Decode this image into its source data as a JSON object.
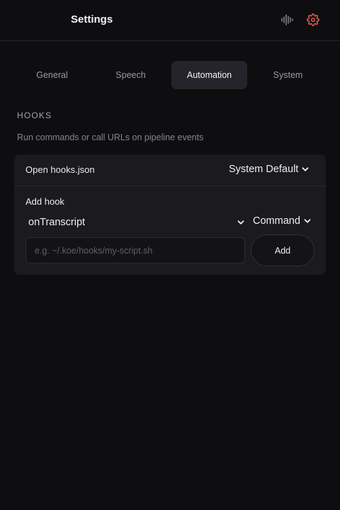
{
  "header": {
    "title": "Settings",
    "icons": {
      "waveform": "waveform-icon",
      "gear": "gear-icon"
    },
    "gear_color": "#e0604f"
  },
  "tabs": [
    {
      "label": "General",
      "active": false
    },
    {
      "label": "Speech",
      "active": false
    },
    {
      "label": "Automation",
      "active": true
    },
    {
      "label": "System",
      "active": false
    }
  ],
  "hooks": {
    "section_label": "HOOKS",
    "description": "Run commands or call URLs on pipeline events",
    "open_label": "Open hooks.json",
    "open_with": "System Default",
    "add_label": "Add hook",
    "event": "onTranscript",
    "type": "Command",
    "input_placeholder": "e.g. ~/.koe/hooks/my-script.sh",
    "input_value": "",
    "add_button": "Add"
  }
}
